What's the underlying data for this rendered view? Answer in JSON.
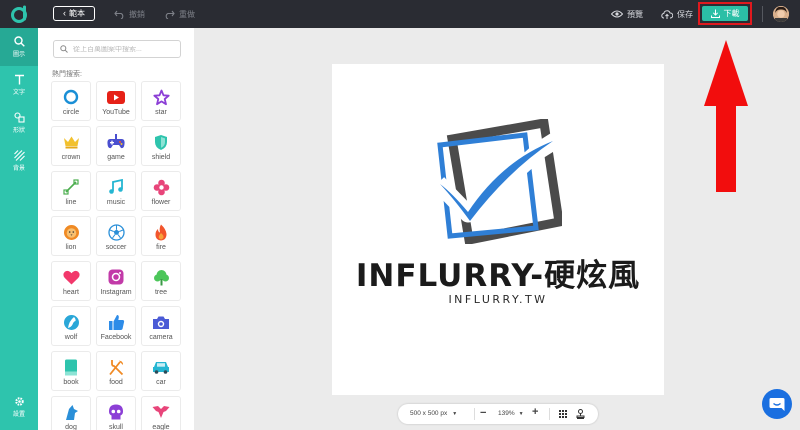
{
  "topbar": {
    "back_label": "範本",
    "undo_label": "撤銷",
    "redo_label": "重做",
    "preview_label": "預覽",
    "save_label": "保存",
    "download_label": "下載"
  },
  "rail": {
    "items": [
      {
        "label": "圖示",
        "icon": "search-icon"
      },
      {
        "label": "文字",
        "icon": "text-icon"
      },
      {
        "label": "形狀",
        "icon": "shapes-icon"
      },
      {
        "label": "背景",
        "icon": "background-icon"
      }
    ],
    "settings_label": "設置"
  },
  "panel": {
    "search_placeholder": "從上百萬圖案中搜索...",
    "hot_title": "熱門搜索:",
    "tiles": [
      {
        "label": "circle",
        "icon": "circle-icon",
        "color": "#1a8fd6"
      },
      {
        "label": "YouTube",
        "icon": "youtube-icon",
        "color": "#e62117"
      },
      {
        "label": "star",
        "icon": "star-icon",
        "color": "#8c3fd6"
      },
      {
        "label": "crown",
        "icon": "crown-icon",
        "color": "#f2c12e"
      },
      {
        "label": "game",
        "icon": "gamepad-icon",
        "color": "#4a4fcf"
      },
      {
        "label": "shield",
        "icon": "shield-icon",
        "color": "#2ec4ad"
      },
      {
        "label": "line",
        "icon": "line-icon",
        "color": "#4cae4f"
      },
      {
        "label": "music",
        "icon": "music-icon",
        "color": "#25b6d2"
      },
      {
        "label": "flower",
        "icon": "flower-icon",
        "color": "#e8457a"
      },
      {
        "label": "lion",
        "icon": "lion-icon",
        "color": "#f08a24"
      },
      {
        "label": "soccer",
        "icon": "soccer-ball-icon",
        "color": "#2a8fd8"
      },
      {
        "label": "fire",
        "icon": "fire-icon",
        "color": "#f2552c"
      },
      {
        "label": "heart",
        "icon": "heart-icon",
        "color": "#f2386b"
      },
      {
        "label": "Instagram",
        "icon": "instagram-icon",
        "color": "#c23aa8"
      },
      {
        "label": "tree",
        "icon": "tree-icon",
        "color": "#4cc65a"
      },
      {
        "label": "wolf",
        "icon": "wolf-icon",
        "color": "#2aa7d8"
      },
      {
        "label": "Facebook",
        "icon": "thumbs-up-icon",
        "color": "#2d8ce8"
      },
      {
        "label": "camera",
        "icon": "camera-icon",
        "color": "#4b5bd6"
      },
      {
        "label": "book",
        "icon": "book-icon",
        "color": "#2ec4ad"
      },
      {
        "label": "food",
        "icon": "food-icon",
        "color": "#f08a24"
      },
      {
        "label": "car",
        "icon": "car-icon",
        "color": "#25b6d2"
      },
      {
        "label": "dog",
        "icon": "dog-icon",
        "color": "#2a8fd8"
      },
      {
        "label": "skull",
        "icon": "skull-icon",
        "color": "#8c3fd6"
      },
      {
        "label": "eagle",
        "icon": "eagle-icon",
        "color": "#e8457a"
      }
    ]
  },
  "canvas": {
    "title": "INFLURRY-硬炫風",
    "subtitle": "INFLURRY.TW",
    "logo_blue": "#2f7fd6",
    "logo_gray": "#4b4b4b"
  },
  "zoom": {
    "size_label": "500 x 500 px",
    "zoom_label": "139%"
  },
  "colors": {
    "accent": "#2ec4ad",
    "topbar": "#2a2c33",
    "highlight": "#e0191e",
    "chat": "#1a6fe0"
  }
}
